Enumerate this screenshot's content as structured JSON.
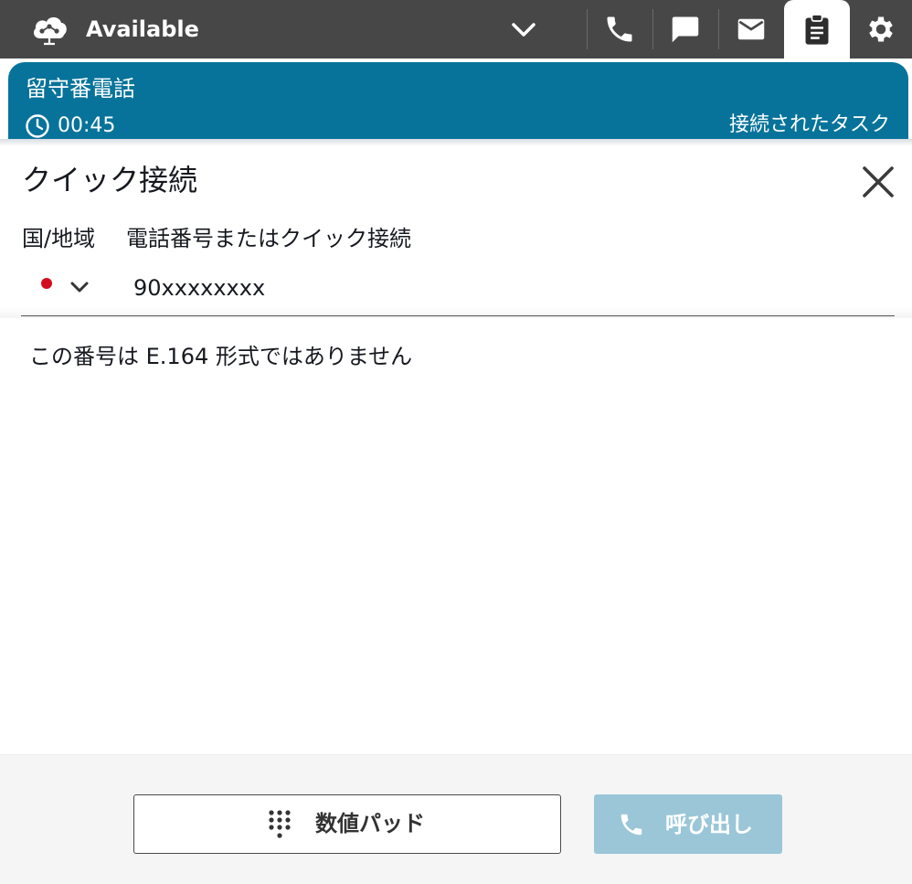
{
  "header": {
    "status": "Available",
    "nav_icons": [
      "phone-icon",
      "chat-icon",
      "mail-icon",
      "clipboard-icon",
      "gear-icon"
    ],
    "active_nav": "clipboard-icon"
  },
  "contact": {
    "title": "留守番電話",
    "timer": "00:45",
    "state": "接続されたタスク"
  },
  "quick_connect": {
    "title": "クイック接続",
    "country_label": "国/地域",
    "phone_label": "電話番号またはクイック接続",
    "phone_value": "90xxxxxxxx",
    "error": "この番号は E.164 形式ではありません"
  },
  "footer": {
    "numpad_label": "数値パッド",
    "call_label": "呼び出し"
  },
  "colors": {
    "topbar": "#474747",
    "contact_card": "#07739b",
    "call_button_disabled": "#9ac6d8",
    "flag_red": "#d20f1f"
  }
}
